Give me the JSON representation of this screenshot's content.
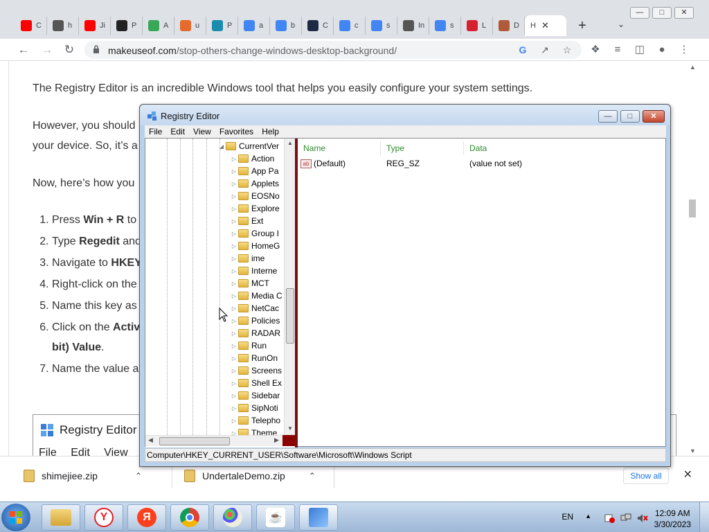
{
  "browser": {
    "tabs": [
      {
        "letter": "C",
        "icon": "youtube-icon",
        "color": "#ff0000"
      },
      {
        "letter": "h",
        "icon": "globe-icon",
        "color": "#555555"
      },
      {
        "letter": "Ji",
        "icon": "youtube-icon",
        "color": "#ff0000"
      },
      {
        "letter": "P",
        "icon": "dp-icon",
        "color": "#222222"
      },
      {
        "letter": "A",
        "icon": "pinwheel-icon",
        "color": "#3aa757"
      },
      {
        "letter": "u",
        "icon": "rainbow-icon",
        "color": "#e66a2c"
      },
      {
        "letter": "P",
        "icon": "e-icon",
        "color": "#1a8cb0"
      },
      {
        "letter": "a",
        "icon": "google-icon",
        "color": "#4285f4"
      },
      {
        "letter": "b",
        "icon": "google-icon",
        "color": "#4285f4"
      },
      {
        "letter": "C",
        "icon": "dark-square-icon",
        "color": "#1e2a45"
      },
      {
        "letter": "c",
        "icon": "google-icon",
        "color": "#4285f4"
      },
      {
        "letter": "s",
        "icon": "google-icon",
        "color": "#4285f4"
      },
      {
        "letter": "In",
        "icon": "speaker-icon",
        "color": "#555555"
      },
      {
        "letter": "s",
        "icon": "google-icon",
        "color": "#4285f4"
      },
      {
        "letter": "L",
        "icon": "heart-icon",
        "color": "#d62030"
      },
      {
        "letter": "D",
        "icon": "document-icon",
        "color": "#b05a3a"
      }
    ],
    "active_tab": {
      "letter": "H",
      "close": "✕"
    },
    "new_tab": "+",
    "url_domain": "makeuseof.com",
    "url_path": "/stop-others-change-windows-desktop-background/"
  },
  "article": {
    "p1": "The Registry Editor is an incredible Windows tool that helps you easily configure your system settings.",
    "p2a": "However, you should",
    "p2b": "your device. So, it’s a",
    "p3": "Now, here’s how you",
    "steps": [
      {
        "pre": "Press ",
        "bold": "Win + R",
        "post": " to o"
      },
      {
        "pre": "Type ",
        "bold": "Regedit",
        "post": " and"
      },
      {
        "pre": "Navigate to ",
        "bold": "HKEY_",
        "post": ""
      },
      {
        "pre": "Right-click on the",
        "bold": "",
        "post": ""
      },
      {
        "pre": "Name this key as A",
        "bold": "",
        "post": ""
      },
      {
        "pre": "Click on the ",
        "bold": "Active",
        "post": ""
      },
      {
        "pre": "Name the value as",
        "bold": "",
        "post": ""
      }
    ],
    "step6_cont": "bit) Value",
    "step6_dot": ".",
    "embedded_title": "Registry Editor",
    "embedded_menu": "File Edit View Fa"
  },
  "downloads": {
    "items": [
      {
        "name": "shimejiee.zip"
      },
      {
        "name": "UndertaleDemo.zip"
      }
    ],
    "show_all": "Show all",
    "close": "✕"
  },
  "regedit": {
    "title": "Registry Editor",
    "menu": [
      "File",
      "Edit",
      "View",
      "Favorites",
      "Help"
    ],
    "tree_parent": "CurrentVer",
    "tree_items": [
      "Action",
      "App Pa",
      "Applets",
      "EOSNo",
      "Explore",
      "Ext",
      "Group I",
      "HomeG",
      "ime",
      "Interne",
      "MCT",
      "Media C",
      "NetCac",
      "Policies",
      "RADAR",
      "Run",
      "RunOn",
      "Screens",
      "Shell Ex",
      "Sidebar",
      "SipNoti",
      "Telepho",
      "Theme"
    ],
    "columns": {
      "name": "Name",
      "type": "Type",
      "data": "Data"
    },
    "values": [
      {
        "name": "(Default)",
        "type": "REG_SZ",
        "data": "(value not set)"
      }
    ],
    "status_path": "Computer\\HKEY_CURRENT_USER\\Software\\Microsoft\\Windows Script"
  },
  "taskbar": {
    "lang": "EN",
    "time": "12:09 AM",
    "date": "3/30/2023",
    "apps": [
      "file-explorer-icon",
      "yandex-browser-icon",
      "yandex-icon",
      "chrome-icon",
      "paint-icon",
      "java-icon",
      "regedit-icon"
    ]
  }
}
